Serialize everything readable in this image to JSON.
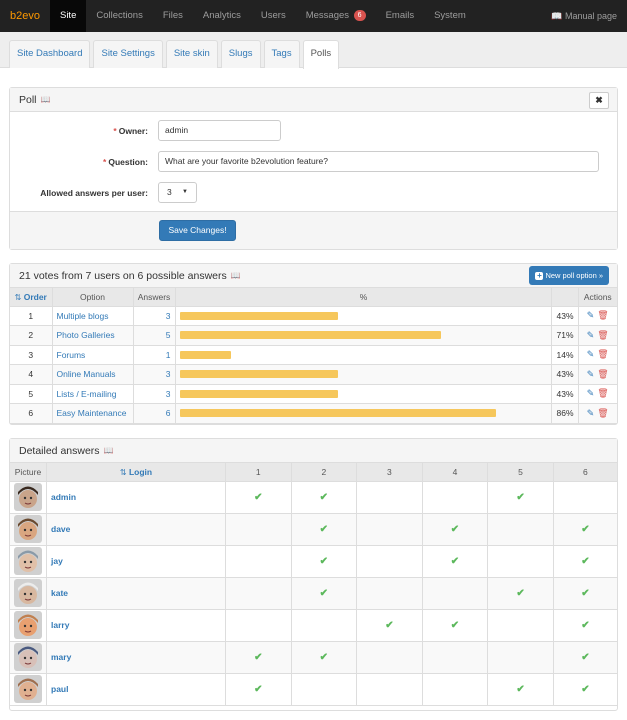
{
  "topnav": {
    "brand": "b2evo",
    "items": [
      "Site",
      "Collections",
      "Files",
      "Analytics",
      "Users",
      "Messages",
      "Emails",
      "System"
    ],
    "messages_badge": "6",
    "manual_label": "Manual page"
  },
  "tabs": [
    "Site Dashboard",
    "Site Settings",
    "Site skin",
    "Slugs",
    "Tags",
    "Polls"
  ],
  "poll_form": {
    "title": "Poll",
    "owner_label": "Owner:",
    "owner_value": "admin",
    "question_label": "Question:",
    "question_value": "What are your favorite b2evolution feature?",
    "allowed_label": "Allowed answers per user:",
    "allowed_value": "3",
    "save_label": "Save Changes!",
    "close_symbol": "✖"
  },
  "options_table": {
    "title": "21 votes from 7 users on 6 possible answers",
    "new_button": "New poll option »",
    "headers": [
      "Order",
      "Option",
      "Answers",
      "%",
      "Actions"
    ],
    "rows": [
      {
        "order": "1",
        "option": "Multiple blogs",
        "answers": "3",
        "pct": "43%",
        "frac": 0.43
      },
      {
        "order": "2",
        "option": "Photo Galleries",
        "answers": "5",
        "pct": "71%",
        "frac": 0.71
      },
      {
        "order": "3",
        "option": "Forums",
        "answers": "1",
        "pct": "14%",
        "frac": 0.14
      },
      {
        "order": "4",
        "option": "Online Manuals",
        "answers": "3",
        "pct": "43%",
        "frac": 0.43
      },
      {
        "order": "5",
        "option": "Lists / E-mailing",
        "answers": "3",
        "pct": "43%",
        "frac": 0.43
      },
      {
        "order": "6",
        "option": "Easy Maintenance",
        "answers": "6",
        "pct": "86%",
        "frac": 0.86
      }
    ]
  },
  "detailed": {
    "title": "Detailed answers",
    "headers": [
      "Picture",
      "Login",
      "1",
      "2",
      "3",
      "4",
      "5",
      "6"
    ],
    "rows": [
      {
        "login": "admin",
        "votes": [
          1,
          1,
          0,
          0,
          1,
          0
        ],
        "skin": "#c9a48a",
        "hair": "#3a2a20"
      },
      {
        "login": "dave",
        "votes": [
          0,
          1,
          0,
          1,
          0,
          1
        ],
        "skin": "#d9a680",
        "hair": "#6b4b30"
      },
      {
        "login": "jay",
        "votes": [
          0,
          1,
          0,
          1,
          0,
          1
        ],
        "skin": "#e0c0a8",
        "hair": "#8a9aa8"
      },
      {
        "login": "kate",
        "votes": [
          0,
          1,
          0,
          0,
          1,
          1
        ],
        "skin": "#d8b8a0",
        "hair": "#ececec"
      },
      {
        "login": "larry",
        "votes": [
          0,
          0,
          1,
          1,
          0,
          1
        ],
        "skin": "#e8a070",
        "hair": "#c08050"
      },
      {
        "login": "mary",
        "votes": [
          1,
          1,
          0,
          0,
          0,
          1
        ],
        "skin": "#d8c0b8",
        "hair": "#4a5a80"
      },
      {
        "login": "paul",
        "votes": [
          1,
          0,
          0,
          0,
          1,
          1
        ],
        "skin": "#e0b090",
        "hair": "#a07050"
      }
    ]
  }
}
